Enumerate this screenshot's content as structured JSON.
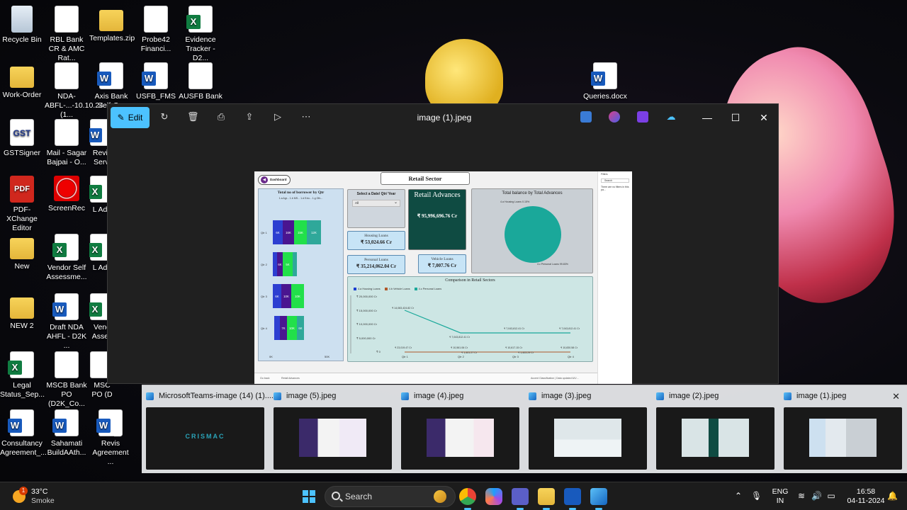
{
  "desktop": {
    "icons": [
      {
        "label": "Recycle Bin"
      },
      {
        "label": "RBL Bank CR & AMC Rat..."
      },
      {
        "label": "Templates.zip"
      },
      {
        "label": "Probe42 Financi..."
      },
      {
        "label": "Evidence Tracker - D2..."
      },
      {
        "label": "Work-Order"
      },
      {
        "label": "NDA-ABFL-...-10.10.24 (1..."
      },
      {
        "label": "Axis Bank Self-C..."
      },
      {
        "label": "USFB_FMS"
      },
      {
        "label": "AUSFB Bank"
      },
      {
        "label": "Queries.docx"
      },
      {
        "label": "GSTSigner"
      },
      {
        "label": "Mail - Sagar Bajpai - O..."
      },
      {
        "label": "Revis Servi"
      },
      {
        "label": "PDF-XChange Editor"
      },
      {
        "label": "ScreenRec"
      },
      {
        "label": "L Add"
      },
      {
        "label": "New"
      },
      {
        "label": "Vendor Self Assessme..."
      },
      {
        "label": "L Add"
      },
      {
        "label": "NEW 2"
      },
      {
        "label": "Draft NDA AHFL - D2K ..."
      },
      {
        "label": "Vend Asses"
      },
      {
        "label": "Legal Status_Sep..."
      },
      {
        "label": "MSCB Bank PO (D2K_Co..."
      },
      {
        "label": "MSC PO (D"
      },
      {
        "label": "Consultancy Agreement_..."
      },
      {
        "label": "Sahamati BuildAAth..."
      },
      {
        "label": "Revis Agreement ..."
      }
    ]
  },
  "photos_window": {
    "title": "image (1).jpeg",
    "edit_label": "Edit"
  },
  "dashboard": {
    "back_button": "Dashboard",
    "title": "Retail Sector",
    "borrowers_panel": {
      "title": "Total no of borrower by Qtr",
      "legend": "1.a Agr...  1.b MS...  1.d Edu...  1.g Oth...",
      "quarters": [
        {
          "label": "Qtr 1",
          "segments": [
            "6K",
            "16K",
            "15K",
            "12K"
          ]
        },
        {
          "label": "Qtr 2",
          "segments": [
            "6K",
            "5K"
          ]
        },
        {
          "label": "Qtr 3",
          "segments": [
            "6K",
            "10K",
            "10K"
          ]
        },
        {
          "label": "Qtr 4",
          "segments": [
            "7K",
            "10K",
            "6K"
          ]
        }
      ],
      "axis_min": "0K",
      "axis_max": "50K"
    },
    "date_filter": {
      "label": "Select a Date/ Qtr/ Year",
      "value": "All"
    },
    "retail_advances": {
      "label": "Retail Advances",
      "value": "₹ 95,996,696.76 Cr"
    },
    "housing_loans": {
      "label": "Housing Loans",
      "value": "₹ 53,024.66 Cr"
    },
    "personal_loans": {
      "label": "Personal Loans",
      "value": "₹ 35,214,062.04 Cr"
    },
    "vehicle_loans": {
      "label": "Vehicle Loans",
      "value": "₹ 7,007.76 Cr"
    },
    "pie": {
      "title": "Total balance by Total Advances",
      "label_top": "4.a Housing Loans 0.15%",
      "label_bottom": "4.c Personal Loans 99.83%"
    },
    "comparison": {
      "title": "Comparison in Retail Sectors",
      "legend": [
        "4.a Housing Loans",
        "4.b Vehicle Loans",
        "4.c Personal Loans"
      ],
      "y_ticks": [
        "₹ 20,000,000 Cr",
        "₹ 15,000,000 Cr",
        "₹ 10,000,000 Cr",
        "₹ 5,000,000 Cr",
        "₹ 0"
      ],
      "x_ticks": [
        "Qtr 1",
        "Qtr 2",
        "Qtr 3",
        "Qtr 4"
      ],
      "personal_labels": [
        "₹ 14,083,424.82 Cr",
        "₹ 7,043,812.41 Cr",
        "₹ 7,043,812.41 Cr",
        "₹ 7,043,812.41 Cr"
      ],
      "housing_labels": [
        "₹ 23,019.47 Cr",
        "₹ 10,561.06 Cr",
        "₹ 10,617.15 Cr",
        "₹ 10,830.58 Cr"
      ],
      "vehicle_labels": [
        "₹ 1,401.27 Cr",
        "₹ 1,403.29 Cr"
      ]
    },
    "filters_pane": {
      "title": "Filters",
      "search": "Search",
      "note": "There are no filters in this pa..."
    },
    "status_bar": {
      "left": "Go back",
      "tab": "Retail Advances",
      "right": "Accent Classification  |  Data updated 6/1/..."
    }
  },
  "filmstrip": {
    "items": [
      {
        "name": "MicrosoftTeams-image (14) (1)...."
      },
      {
        "name": "image (5).jpeg"
      },
      {
        "name": "image (4).jpeg"
      },
      {
        "name": "image (3).jpeg"
      },
      {
        "name": "image (2).jpeg"
      },
      {
        "name": "image (1).jpeg"
      }
    ],
    "teams_thumb_text": "CRISMAC"
  },
  "taskbar": {
    "weather_temp": "33°C",
    "weather_desc": "Smoke",
    "weather_badge": "1",
    "search_placeholder": "Search",
    "lang_top": "ENG",
    "lang_bottom": "IN",
    "time": "16:58",
    "date": "04-11-2024"
  }
}
